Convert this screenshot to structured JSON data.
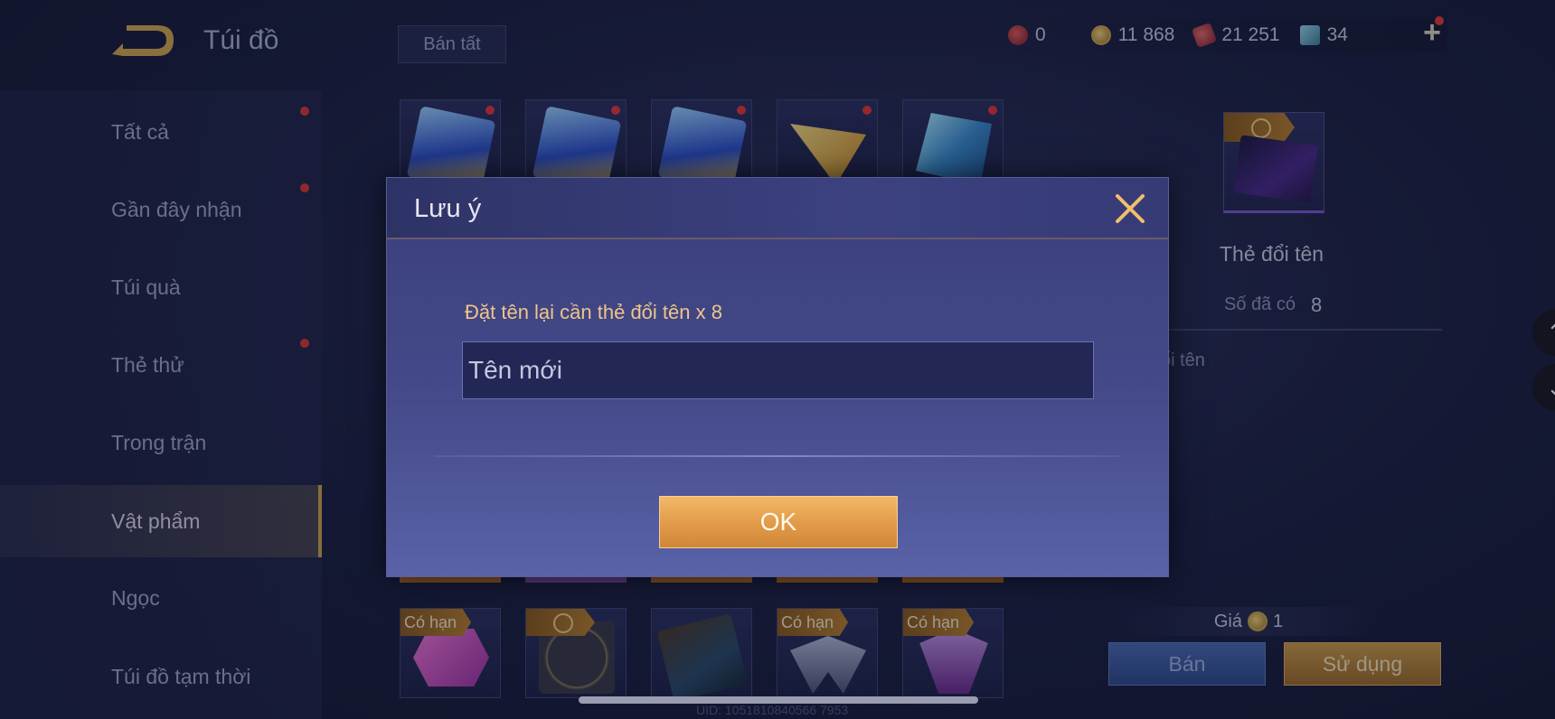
{
  "header": {
    "title": "Túi đồ",
    "sell_all_label": "Bán tất",
    "currencies": [
      {
        "icon": "gem-icon",
        "value": "0"
      },
      {
        "icon": "gold-coin-icon",
        "value": "11 868"
      },
      {
        "icon": "ticket-icon",
        "value": "21 251"
      },
      {
        "icon": "card-icon",
        "value": "34"
      }
    ]
  },
  "sidebar": {
    "items": [
      {
        "label": "Tất cả",
        "has_dot": true
      },
      {
        "label": "Gần đây nhận",
        "has_dot": true
      },
      {
        "label": "Túi quà",
        "has_dot": false
      },
      {
        "label": "Thẻ thử",
        "has_dot": true
      },
      {
        "label": "Trong trận",
        "has_dot": false
      },
      {
        "label": "Vật phẩm",
        "has_dot": false,
        "active": true
      },
      {
        "label": "Ngọc",
        "has_dot": false
      },
      {
        "label": "Túi đồ tạm thời",
        "has_dot": false
      }
    ]
  },
  "grid": {
    "bottom_tags": [
      "Có hạn",
      "Có hạn",
      "Có hạn",
      "Có hạn"
    ]
  },
  "detail": {
    "name": "Thẻ đổi tên",
    "owned_label": "Số đã có",
    "owned_value": "8",
    "description": "ổi tên",
    "price_label": "Giá",
    "price_value": "1",
    "sell_label": "Bán",
    "use_label": "Sử dụng"
  },
  "footer": {
    "uid": "UID: 1051810840566 7953"
  },
  "modal": {
    "title": "Lưu ý",
    "hint": "Đặt tên lại cần thẻ đổi tên x 8",
    "input_placeholder": "Tên mới",
    "ok_label": "OK"
  },
  "colors": {
    "accent_gold": "#e09a48",
    "notify_red": "#e03838",
    "hint_text": "#f0c48a"
  }
}
